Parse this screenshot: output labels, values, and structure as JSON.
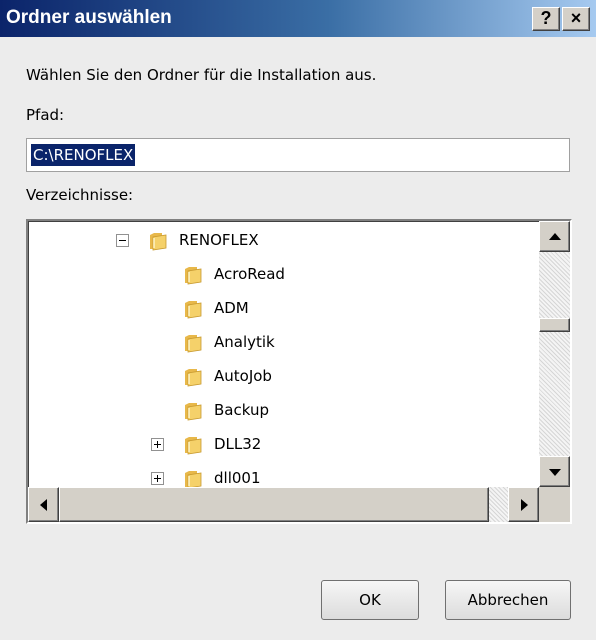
{
  "window": {
    "title": "Ordner auswählen",
    "help_button_label": "?",
    "close_button_label": "×"
  },
  "dialog": {
    "instruction": "Wählen Sie den Ordner für die Installation aus.",
    "path_label": "Pfad:",
    "path_value": "C:\\RENOFLEX",
    "directories_label": "Verzeichnisse:"
  },
  "tree": {
    "items": [
      {
        "label": "RENOFLEX",
        "expander": "minus",
        "level": 0
      },
      {
        "label": "AcroRead",
        "expander": "none",
        "level": 1
      },
      {
        "label": "ADM",
        "expander": "none",
        "level": 1
      },
      {
        "label": "Analytik",
        "expander": "none",
        "level": 1
      },
      {
        "label": "AutoJob",
        "expander": "none",
        "level": 1
      },
      {
        "label": "Backup",
        "expander": "none",
        "level": 1
      },
      {
        "label": "DLL32",
        "expander": "plus",
        "level": 1
      },
      {
        "label": "dll001",
        "expander": "plus",
        "level": 1
      }
    ],
    "folder_color": "#f5d16a"
  },
  "buttons": {
    "ok": "OK",
    "cancel": "Abbrechen"
  }
}
